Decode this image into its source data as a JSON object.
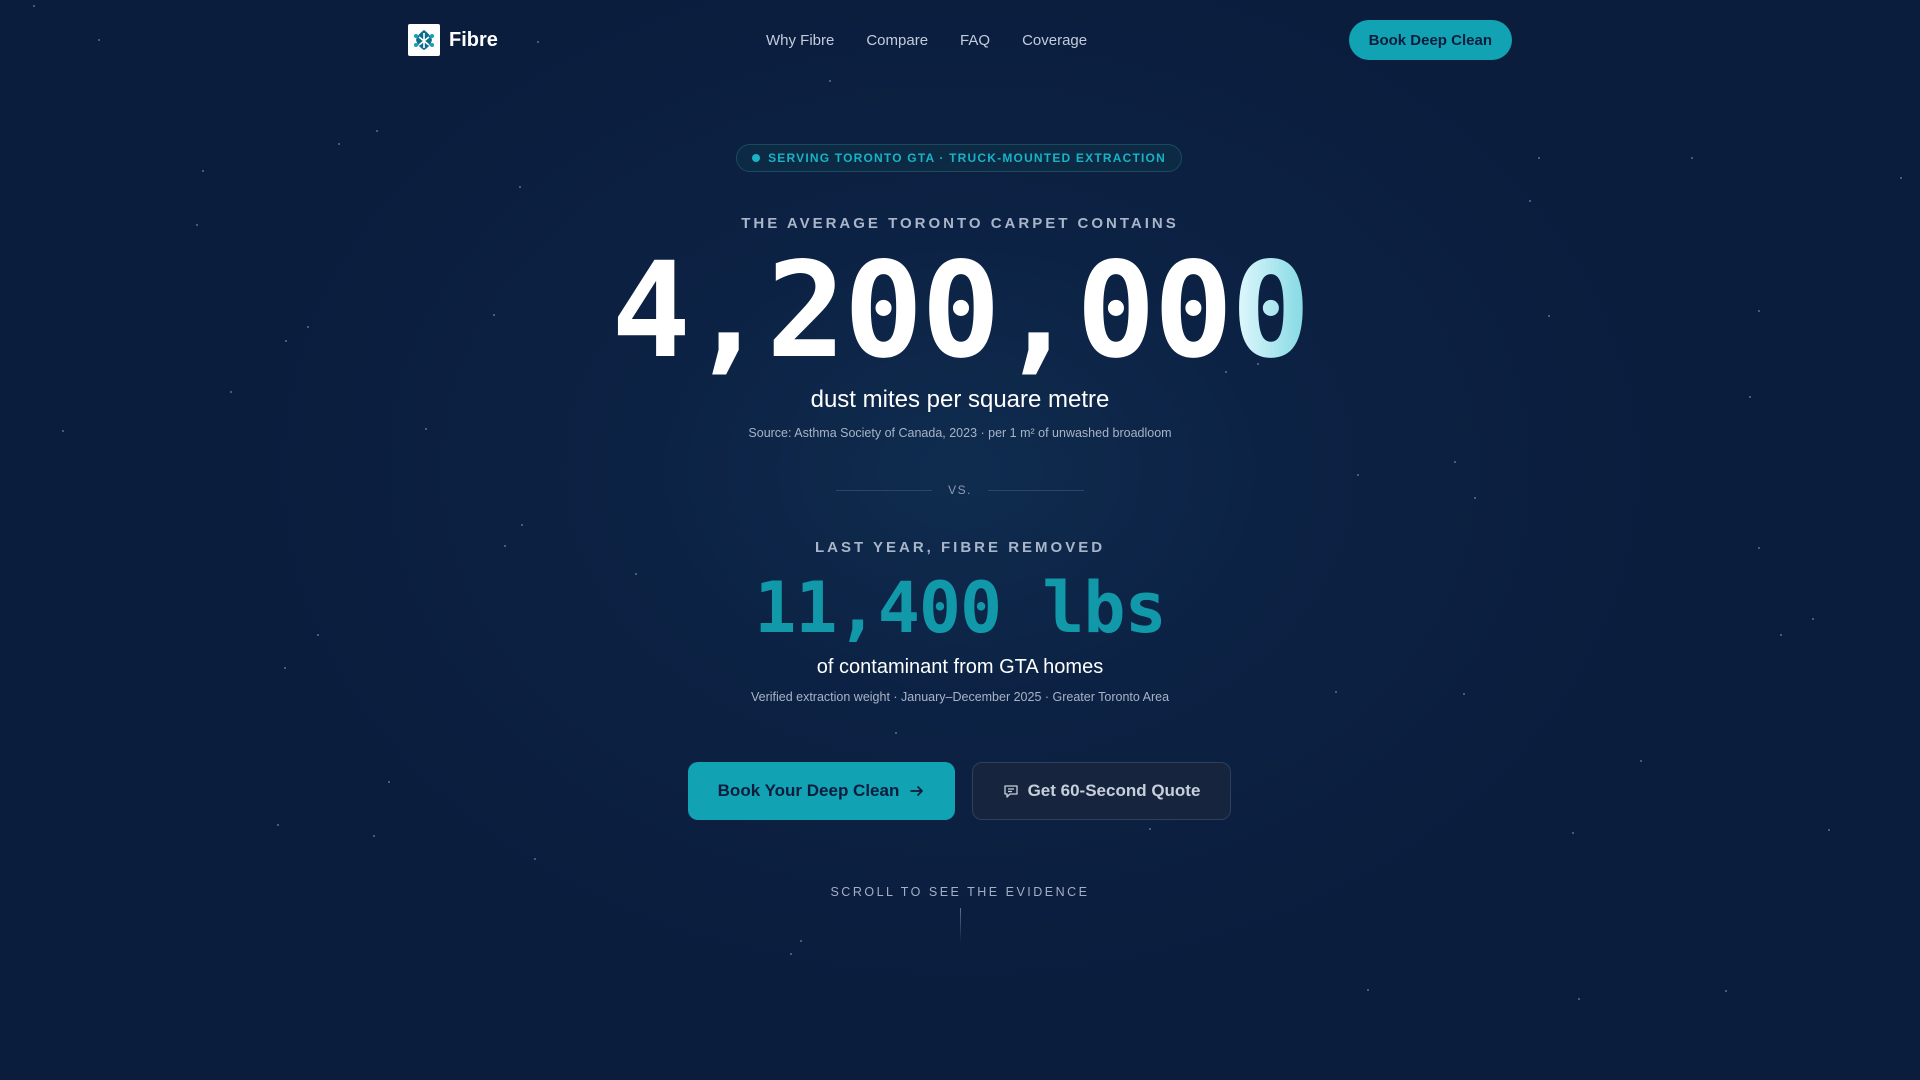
{
  "nav": {
    "brand": "Fibre",
    "links": [
      {
        "label": "Why Fibre"
      },
      {
        "label": "Compare"
      },
      {
        "label": "FAQ"
      },
      {
        "label": "Coverage"
      }
    ],
    "cta_label": "Book Deep Clean"
  },
  "hero": {
    "badge_text": "SERVING TORONTO GTA · TRUCK-MOUNTED EXTRACTION",
    "stat1": {
      "eyebrow": "THE AVERAGE TORONTO CARPET CONTAINS",
      "number_main": "4,200,00",
      "number_fade": "0",
      "unit_line": "dust mites per square metre",
      "source": "Source: Asthma Society of Canada, 2023 · per 1 m² of unwashed broadloom"
    },
    "vs_label": "VS.",
    "stat2": {
      "eyebrow": "LAST YEAR, FIBRE REMOVED",
      "number": "11,400 lbs",
      "unit_line": "of contaminant from GTA homes",
      "source": "Verified extraction weight · January–December 2025 · Greater Toronto Area"
    },
    "cta_primary": "Book Your Deep Clean",
    "cta_secondary": "Get 60-Second Quote",
    "scroll_hint": "SCROLL TO SEE THE EVIDENCE"
  },
  "colors": {
    "background": "#0b1d3d",
    "accent": "#11a3b4",
    "text_muted": "#a9b5c9"
  },
  "icons": {
    "brand": "fibre-logo-icon",
    "primary_cta": "arrow-right-icon",
    "secondary_cta": "chat-bubble-icon"
  }
}
